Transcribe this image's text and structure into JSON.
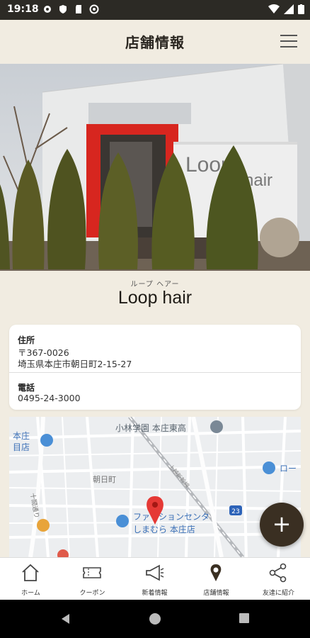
{
  "status_bar": {
    "time": "19:18"
  },
  "header": {
    "title": "店舗情報"
  },
  "shop": {
    "name_ruby": "ループ ヘアー",
    "name": "Loop hair",
    "sign_word1": "Loop",
    "sign_word2": "hair"
  },
  "info": {
    "address_label": "住所",
    "postal": "〒367-0026",
    "address": "埼玉県本庄市朝日町2-15-27",
    "phone_label": "電話",
    "phone": "0495-24-3000"
  },
  "map": {
    "labels": {
      "kobayashi": "小林学園 本庄東高",
      "honjo_left1": "本庄",
      "honjo_left2": "目店",
      "asahicho": "朝日町",
      "fashion1": "ファッションセンタ",
      "fashion2": "しまむら 本庄店",
      "ro": "ロー",
      "route": "23",
      "jitsu": "十間通り",
      "line": "上越新幹線"
    }
  },
  "fab": {
    "label": "+"
  },
  "bottom_nav": {
    "items": [
      {
        "label": "ホーム",
        "icon": "home-icon"
      },
      {
        "label": "クーポン",
        "icon": "coupon-icon"
      },
      {
        "label": "新着情報",
        "icon": "megaphone-icon"
      },
      {
        "label": "店舗情報",
        "icon": "location-pin-icon"
      },
      {
        "label": "友達に紹介",
        "icon": "share-icon"
      }
    ]
  },
  "colors": {
    "header_bg": "#f1ece1",
    "fab_bg": "#3a2f22",
    "pin": "#e53935",
    "status_bg": "#2c2a25"
  }
}
